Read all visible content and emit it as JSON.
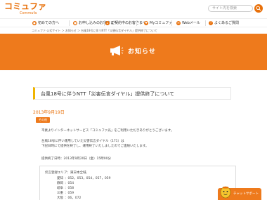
{
  "brand": {
    "logo_text": "コミュファ",
    "logo_sub": "Commufa"
  },
  "search": {
    "placeholder": "サイト内を検索",
    "button_icon": "search-icon"
  },
  "nav": {
    "items": [
      {
        "label": "初めての方へ",
        "icon": "person-icon"
      },
      {
        "label": "お申し込みのお客さまへ",
        "icon": "document-icon"
      },
      {
        "label": "ご契約中のお客さまへ",
        "icon": "house-icon"
      },
      {
        "label": "Myコミュファ",
        "icon": "heart-icon"
      },
      {
        "label": "Webメール",
        "icon": "mail-icon"
      },
      {
        "label": "よくあるご質問",
        "icon": "question-icon"
      }
    ]
  },
  "breadcrumb": "コミュファ 公式サイト ＞ お知らせ ＞ 台風18号に伴うNTT「災害伝言ダイヤル」提供終了について",
  "banner": {
    "title": "お知らせ",
    "icon": "megaphone-icon"
  },
  "article": {
    "title": "台風18号に伴うNTT「災害伝言ダイヤル」提供終了について",
    "date": "2013年9月19日",
    "tag": "その他",
    "paragraphs": [
      "平素よりインターネットサービス「コミュファ光」をご利用いただきありがとうございます。",
      "台風18号に伴い運用していた災害伝言ダイヤル（171）は",
      "下記日時にて提供を終了し、運用終了いたしましたのでご連絡いたします。",
      "提供終了日時：2013年9月20日（金）15時00分"
    ],
    "info": {
      "heading": "伝言登録エリア：東日本全域、",
      "rows": [
        {
          "label": "愛知",
          "value": "：052，053，054，057，059"
        },
        {
          "label": "静岡",
          "value": "：054"
        },
        {
          "label": "岐阜",
          "value": "：058"
        },
        {
          "label": "三重",
          "value": "：059"
        },
        {
          "label": "大阪",
          "value": "：06，072"
        }
      ]
    }
  },
  "chat": {
    "label": "チャットサポート",
    "icon": "mascot-icon"
  },
  "colors": {
    "accent": "#ee7a1c",
    "brand": "#e8700a",
    "title_bar": "#f0b400"
  }
}
